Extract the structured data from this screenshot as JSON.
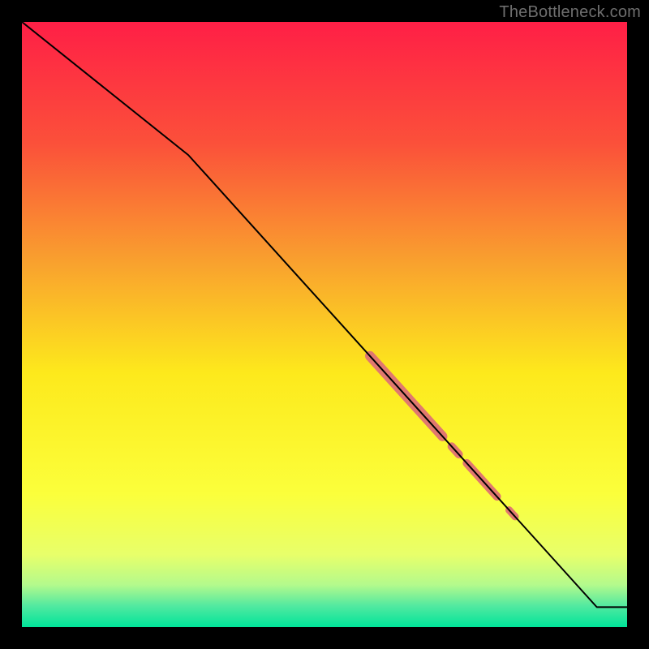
{
  "attribution": "TheBottleneck.com",
  "chart_data": {
    "type": "line",
    "title": "",
    "xlabel": "",
    "ylabel": "",
    "xlim": [
      0,
      100
    ],
    "ylim": [
      0,
      100
    ],
    "grid": false,
    "legend": false,
    "background_gradient": {
      "stops": [
        {
          "offset": 0.0,
          "color": "#ff1f46"
        },
        {
          "offset": 0.2,
          "color": "#fb503a"
        },
        {
          "offset": 0.4,
          "color": "#f9a22e"
        },
        {
          "offset": 0.58,
          "color": "#fde91c"
        },
        {
          "offset": 0.78,
          "color": "#fbff3b"
        },
        {
          "offset": 0.88,
          "color": "#e8ff6a"
        },
        {
          "offset": 0.93,
          "color": "#b4fa8c"
        },
        {
          "offset": 0.965,
          "color": "#52e9a0"
        },
        {
          "offset": 1.0,
          "color": "#00e49a"
        }
      ]
    },
    "series": [
      {
        "name": "curve",
        "color": "#000000",
        "stroke_width": 2,
        "x": [
          0.0,
          27.5,
          95.0,
          100.0
        ],
        "y": [
          100.0,
          78.0,
          3.3,
          3.3
        ]
      }
    ],
    "highlight_segments": {
      "color": "#e0786f",
      "segments": [
        {
          "x_start": 57.5,
          "x_end": 69.5,
          "width": 12
        },
        {
          "x_start": 71.0,
          "x_end": 72.2,
          "width": 10
        },
        {
          "x_start": 73.5,
          "x_end": 78.5,
          "width": 10
        },
        {
          "x_start": 80.5,
          "x_end": 81.5,
          "width": 9
        }
      ]
    }
  }
}
